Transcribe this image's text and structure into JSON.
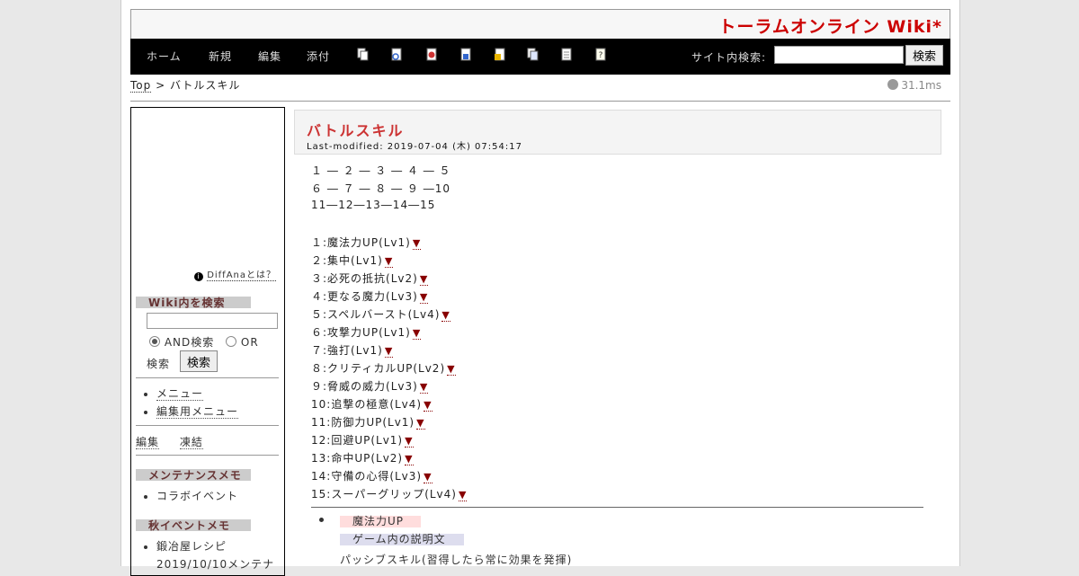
{
  "site": {
    "title": "トーラムオンライン Wiki*"
  },
  "nav": {
    "links": [
      "ホーム",
      "新規",
      "編集",
      "添付"
    ],
    "icons": [
      "copy-icon",
      "diff-icon",
      "backup-icon",
      "save-icon",
      "lock-icon",
      "list-icon",
      "page-icon",
      "help-icon"
    ],
    "search_label": "サイト内検索:",
    "search_button": "検索"
  },
  "breadcrumb": {
    "top": "Top",
    "separator": ">",
    "current": "バトルスキル"
  },
  "timing": "31.1ms",
  "sidebar": {
    "ad_link": "DiffAnaとは？",
    "wiki_search": {
      "heading": "Wiki内を検索",
      "and_label": "AND検索",
      "or_label": "OR",
      "search_text": "検索",
      "button": "検索"
    },
    "menu_items": [
      "メニュー",
      "編集用メニュー"
    ],
    "edit_links": [
      "編集",
      "凍結"
    ],
    "maintenance": {
      "heading": "メンテナンスメモ",
      "items": [
        "コラボイベント"
      ]
    },
    "autumn": {
      "heading": "秋イベントメモ",
      "items": [
        "鍛冶屋レシピ",
        "2019/10/10メンテナ"
      ]
    }
  },
  "content": {
    "title": "バトルスキル",
    "modified": "Last-modified: 2019-07-04 (木) 07:54:17",
    "tree_lines": [
      "１ ― ２ ― ３ ― ４ ― ５",
      "６ ― ７ ― ８ ― ９ ―10",
      "11―12―13―14―15"
    ],
    "skills": [
      "１:魔法力UP(Lv1)",
      "２:集中(Lv1)",
      "３:必死の抵抗(Lv2)",
      "４:更なる魔力(Lv3)",
      "５:スペルバースト(Lv4)",
      "６:攻撃力UP(Lv1)",
      "７:強打(Lv1)",
      "８:クリティカルUP(Lv2)",
      "９:脅威の威力(Lv3)",
      "10:追撃の極意(Lv4)",
      "11:防御力UP(Lv1)",
      "12:回避UP(Lv1)",
      "13:命中UP(Lv2)",
      "14:守備の心得(Lv3)",
      "15:スーパーグリップ(Lv4)"
    ],
    "anchor_mark": "▼",
    "detail": {
      "name": "魔法力UP",
      "label": "ゲーム内の説明文",
      "text": "パッシブスキル(習得したら常に効果を発揮)"
    }
  }
}
